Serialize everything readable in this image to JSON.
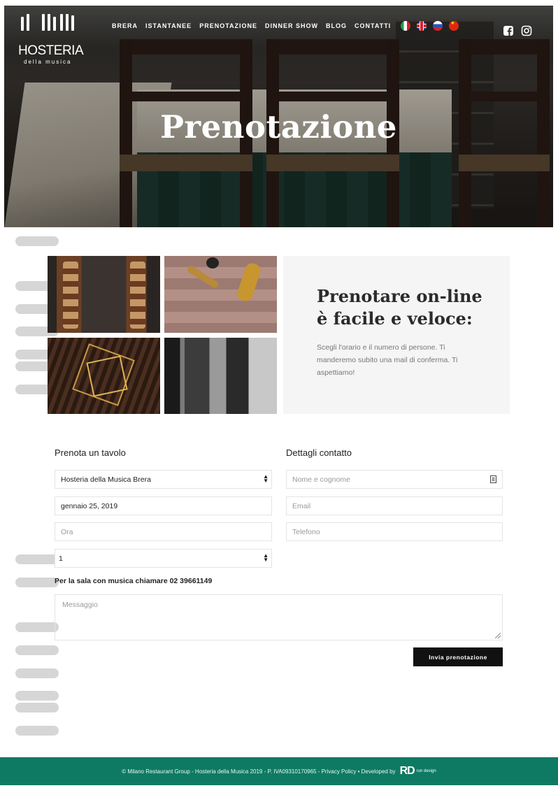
{
  "header": {
    "logo": {
      "name": "HOSTERIA",
      "subtitle": "della musica"
    },
    "nav": [
      "BRERA",
      "ISTANTANEE",
      "PRENOTAZIONE",
      "DINNER SHOW",
      "BLOG",
      "CONTATTI"
    ],
    "languages": [
      {
        "icon": "flag-italy-icon"
      },
      {
        "icon": "flag-uk-icon"
      },
      {
        "icon": "flag-russia-icon"
      },
      {
        "icon": "flag-china-icon"
      }
    ],
    "social": [
      {
        "icon": "facebook-icon"
      },
      {
        "icon": "instagram-icon"
      }
    ]
  },
  "hero": {
    "title": "Prenotazione"
  },
  "intro": {
    "title_line1": "Prenotare on-line",
    "title_line2": "è facile e veloce:",
    "text": "Scegli l'orario e il numero di persone. Ti manderemo subito una mail di conferma. Ti aspettiamo!"
  },
  "form": {
    "left_title": "Prenota un tavolo",
    "right_title": "Dettagli contatto",
    "location": {
      "value": "Hosteria della Musica Brera"
    },
    "date": {
      "value": "gennaio 25, 2019"
    },
    "time": {
      "placeholder": "Ora"
    },
    "guests": {
      "value": "1"
    },
    "name": {
      "placeholder": "Nome e cognome"
    },
    "email": {
      "placeholder": "Email"
    },
    "phone": {
      "placeholder": "Telefono"
    },
    "phone_note": "Per la sala con musica chiamare 02 39661149",
    "message": {
      "placeholder": "Messaggio"
    },
    "submit_label": "Invia prenotazione"
  },
  "footer": {
    "text": "© Milano Restaurant Group - Hosteria della Musica 2019 - P. IVA09310170965 - Privacy Policy • Developed by",
    "brand_mark": "RD",
    "brand_word": "run design"
  },
  "colors": {
    "footer_bg": "#0f7a63",
    "button_bg": "#111111",
    "intro_bg": "#f5f5f5"
  }
}
